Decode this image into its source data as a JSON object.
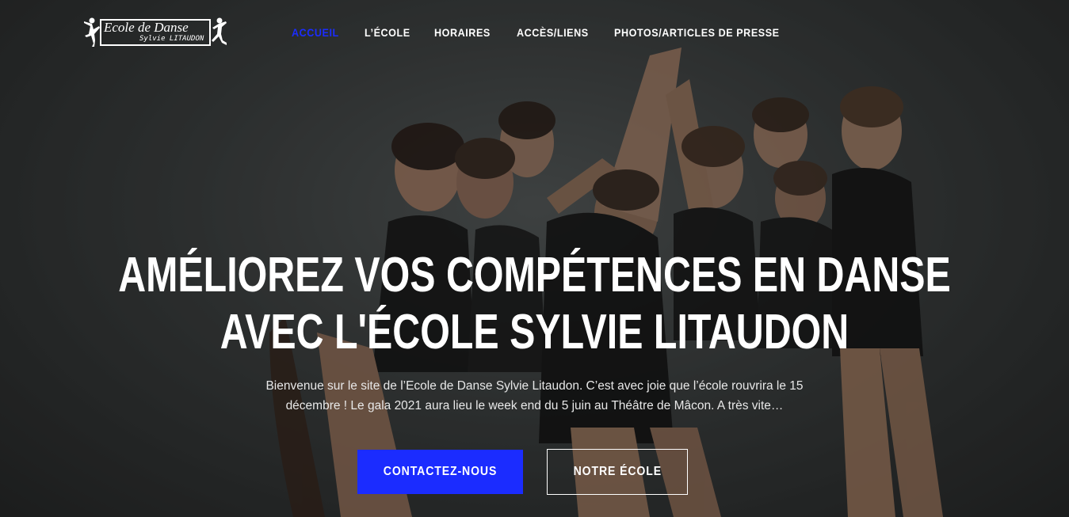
{
  "logo": {
    "line1": "Ecole de Danse",
    "line2": "Sylvie LITAUDON",
    "icon_left": "dancer-icon",
    "icon_right": "dancer-icon"
  },
  "nav": {
    "items": [
      {
        "label": "ACCUEIL",
        "active": true
      },
      {
        "label": "L’ÉCOLE",
        "active": false
      },
      {
        "label": "HORAIRES",
        "active": false
      },
      {
        "label": "ACCÈS/LIENS",
        "active": false
      },
      {
        "label": "PHOTOS/ARTICLES DE PRESSE",
        "active": false
      }
    ]
  },
  "hero": {
    "headline_line1": "AMÉLIOREZ VOS COMPÉTENCES EN DANSE",
    "headline_line2": "AVEC L'ÉCOLE SYLVIE LITAUDON",
    "intro": "Bienvenue sur le site de l’Ecole de Danse Sylvie Litaudon. C’est avec joie que l’école rouvrira le 15 décembre ! Le gala 2021 aura lieu le week end du 5 juin au Théâtre de Mâcon. A très vite…",
    "primary_button": "CONTACTEZ-NOUS",
    "secondary_button": "NOTRE ÉCOLE"
  },
  "colors": {
    "accent": "#1b2cff",
    "text": "#ffffff",
    "background": "#3f4343"
  }
}
